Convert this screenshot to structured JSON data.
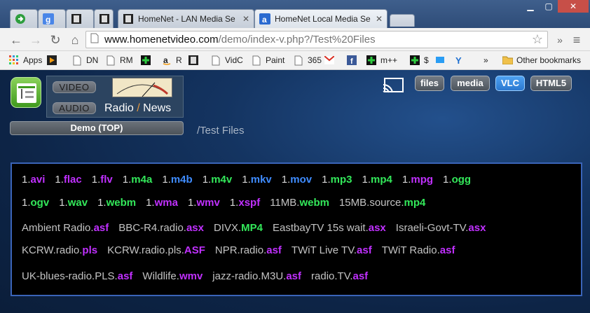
{
  "browser": {
    "tabs": [
      {
        "title": "",
        "icon": "green-arrow-icon"
      },
      {
        "title": "",
        "icon": "google-icon"
      },
      {
        "title": "",
        "icon": "film-icon"
      },
      {
        "title": "HomeNet - LAN Media Se",
        "icon": "film-icon",
        "active": false
      },
      {
        "title": "HomeNet Local Media Se",
        "icon": "amazon-icon",
        "active": true
      }
    ],
    "url_host": "www.homenetvideo.com",
    "url_path": "/demo/index-v.php?/Test%20Files",
    "bookmarks": [
      {
        "label": "Apps",
        "icon": "apps-icon"
      },
      {
        "label": "",
        "icon": "play-icon"
      },
      {
        "label": "DN",
        "icon": "page-icon"
      },
      {
        "label": "RM",
        "icon": "page-icon"
      },
      {
        "label": "",
        "icon": "plus-icon"
      },
      {
        "label": "R",
        "icon": "amazon-icon"
      },
      {
        "label": "",
        "icon": "film-icon"
      },
      {
        "label": "VidC",
        "icon": "page-icon"
      },
      {
        "label": "Paint",
        "icon": "page-icon"
      },
      {
        "label": "365",
        "icon": "page-icon"
      },
      {
        "label": "",
        "icon": "gmail-icon"
      },
      {
        "label": "",
        "icon": "facebook-icon"
      },
      {
        "label": "m++",
        "icon": "plus-icon"
      },
      {
        "label": "$",
        "icon": "plus-icon"
      },
      {
        "label": "",
        "icon": "monitor-icon"
      },
      {
        "label": "",
        "icon": "yahoo-icon"
      }
    ],
    "overflow_label": "»",
    "other_bookmarks": "Other bookmarks"
  },
  "app": {
    "mode_video": "VIDEO",
    "mode_audio": "AUDIO",
    "radio_label": "Radio",
    "slash": "/",
    "news_label": "News",
    "demo_button": "Demo (TOP)",
    "breadcrumb": "/Test Files",
    "top_buttons": [
      {
        "label": "files",
        "active": false
      },
      {
        "label": "media",
        "active": false
      },
      {
        "label": "VLC",
        "active": true
      },
      {
        "label": "HTML5",
        "active": false
      }
    ]
  },
  "colors": {
    "ext_purple": "#c030ff",
    "ext_blue": "#3f8cff",
    "ext_green": "#33e85a",
    "name_gray": "#c3c3c3",
    "accent_orange": "#e5973b",
    "active_button": "#3b8de6"
  },
  "files": [
    [
      {
        "base": "1.",
        "ext": "avi",
        "c": "#c030ff"
      },
      {
        "base": "1.",
        "ext": "flac",
        "c": "#c030ff"
      },
      {
        "base": "1.",
        "ext": "flv",
        "c": "#c030ff"
      },
      {
        "base": "1.",
        "ext": "m4a",
        "c": "#33e85a"
      },
      {
        "base": "1.",
        "ext": "m4b",
        "c": "#3f8cff"
      },
      {
        "base": "1.",
        "ext": "m4v",
        "c": "#33e85a"
      },
      {
        "base": "1.",
        "ext": "mkv",
        "c": "#3f8cff"
      },
      {
        "base": "1.",
        "ext": "mov",
        "c": "#3f8cff"
      },
      {
        "base": "1.",
        "ext": "mp3",
        "c": "#33e85a"
      },
      {
        "base": "1.",
        "ext": "mp4",
        "c": "#33e85a"
      },
      {
        "base": "1.",
        "ext": "mpg",
        "c": "#c030ff"
      },
      {
        "base": "1.",
        "ext": "ogg",
        "c": "#33e85a"
      }
    ],
    [
      {
        "base": "1.",
        "ext": "ogv",
        "c": "#33e85a"
      },
      {
        "base": "1.",
        "ext": "wav",
        "c": "#33e85a"
      },
      {
        "base": "1.",
        "ext": "webm",
        "c": "#33e85a"
      },
      {
        "base": "1.",
        "ext": "wma",
        "c": "#c030ff"
      },
      {
        "base": "1.",
        "ext": "wmv",
        "c": "#c030ff"
      },
      {
        "base": "1.",
        "ext": "xspf",
        "c": "#c030ff"
      },
      {
        "base": "11MB.",
        "ext": "webm",
        "c": "#33e85a"
      },
      {
        "base": "15MB.source.",
        "ext": "mp4",
        "c": "#33e85a"
      }
    ],
    [
      {
        "base": "Ambient Radio.",
        "ext": "asf",
        "c": "#c030ff"
      },
      {
        "base": "BBC-R4.radio.",
        "ext": "asx",
        "c": "#c030ff"
      },
      {
        "base": "DIVX.",
        "ext": "MP4",
        "c": "#33e85a"
      },
      {
        "base": "EastbayTV 15s wait.",
        "ext": "asx",
        "c": "#c030ff"
      },
      {
        "base": "Israeli-Govt-TV.",
        "ext": "asx",
        "c": "#c030ff"
      }
    ],
    [
      {
        "base": "KCRW.radio.",
        "ext": "pls",
        "c": "#c030ff"
      },
      {
        "base": "KCRW.radio.pls.",
        "ext": "ASF",
        "c": "#c030ff"
      },
      {
        "base": "NPR.radio.",
        "ext": "asf",
        "c": "#c030ff"
      },
      {
        "base": "TWiT Live TV.",
        "ext": "asf",
        "c": "#c030ff"
      },
      {
        "base": "TWiT Radio.",
        "ext": "asf",
        "c": "#c030ff"
      }
    ],
    [
      {
        "base": "UK-blues-radio.PLS.",
        "ext": "asf",
        "c": "#c030ff"
      },
      {
        "base": "Wildlife.",
        "ext": "wmv",
        "c": "#c030ff"
      },
      {
        "base": "jazz-radio.M3U.",
        "ext": "asf",
        "c": "#c030ff"
      },
      {
        "base": "radio.TV.",
        "ext": "asf",
        "c": "#c030ff"
      }
    ]
  ]
}
